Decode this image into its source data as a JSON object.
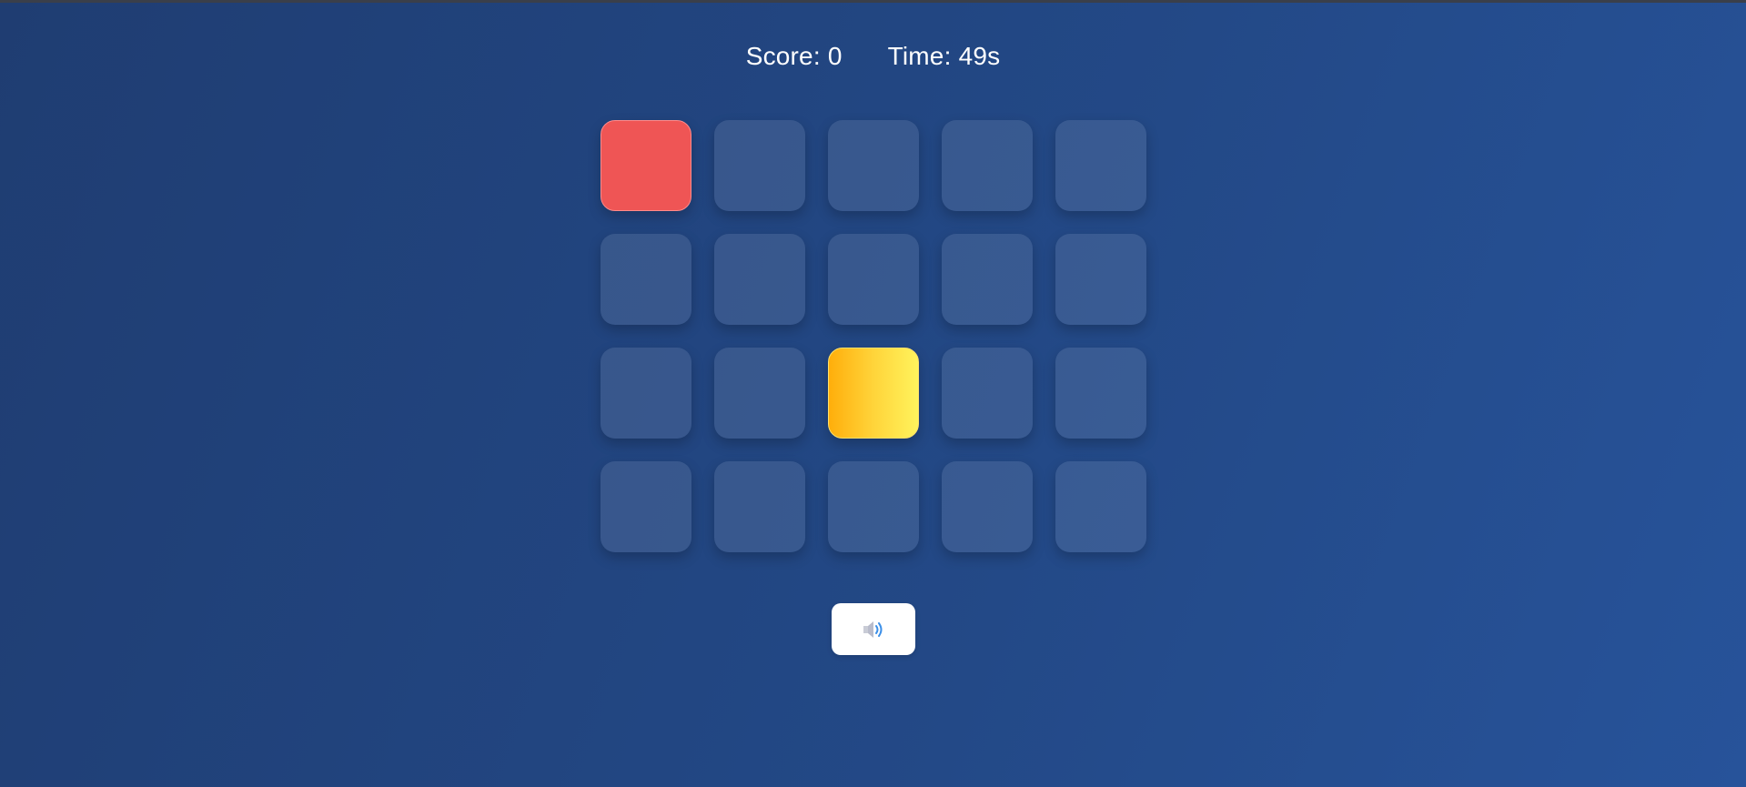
{
  "hud": {
    "score_label": "Score:",
    "score_value": "0",
    "time_label": "Time:",
    "time_value": "49s"
  },
  "grid": {
    "rows": 4,
    "columns": 5,
    "tiles": [
      "red",
      "empty",
      "empty",
      "empty",
      "empty",
      "empty",
      "empty",
      "empty",
      "empty",
      "empty",
      "empty",
      "empty",
      "yellow",
      "empty",
      "empty",
      "empty",
      "empty",
      "empty",
      "empty",
      "empty"
    ]
  },
  "sound_button": {
    "icon": "speaker-icon"
  },
  "colors": {
    "background": "#234987",
    "tile_red": "#ef5555",
    "tile_yellow": "#ffd43a",
    "tile_empty": "#3a5a91"
  }
}
